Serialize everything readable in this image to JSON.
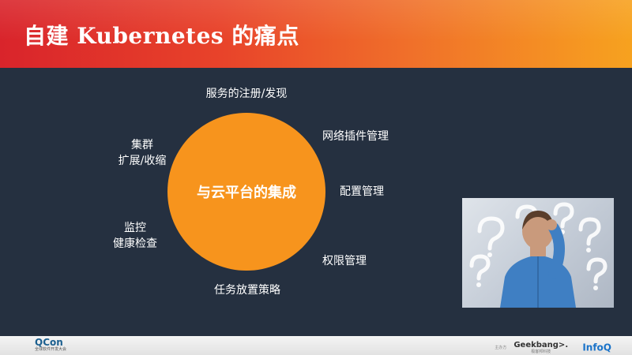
{
  "header": {
    "title": "自建 Kubernetes 的痛点",
    "gradient_start": "#d9242b",
    "gradient_end": "#f7a21f"
  },
  "diagram": {
    "center": "与云平台的集成",
    "center_color": "#f7941d",
    "items": {
      "top": "服务的注册/发现",
      "top_right": "网络插件管理",
      "right": "配置管理",
      "bottom_right": "权限管理",
      "bottom": "任务放置策略",
      "left_lower_line1": "监控",
      "left_lower_line2": "健康检查",
      "left_upper_line1": "集群",
      "left_upper_line2": "扩展/收缩"
    }
  },
  "footer": {
    "qcon": "QCon",
    "qcon_sub": "全球软件开发大会",
    "sponsor_text": "主办方",
    "geekbang": "Geekbang>.",
    "geekbang_sub": "极客邦科技",
    "infoq": "InfoQ"
  },
  "colors": {
    "background": "#253040",
    "footer": "#eeeeee",
    "qcon": "#1b5f8f",
    "infoq": "#1a73c9"
  }
}
